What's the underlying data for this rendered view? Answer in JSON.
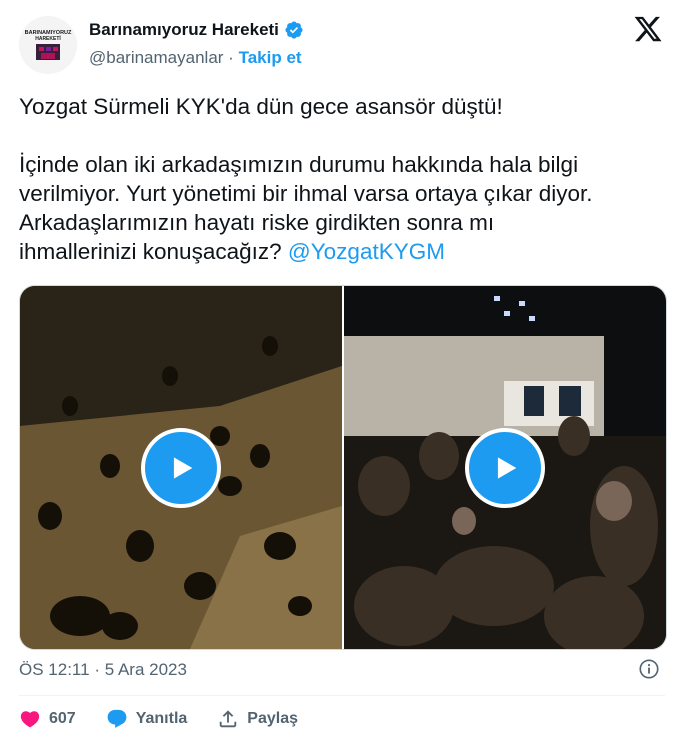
{
  "account": {
    "display_name": "Barınamıyoruz Hareketi",
    "handle": "@barinamayanlar",
    "separator": "·",
    "follow_label": "Takip et",
    "avatar_text_line1": "BARINAMIYORUZ",
    "avatar_text_line2": "HAREKETİ",
    "avatar_icon": "avatar-logo",
    "verified_icon": "verified-badge-icon"
  },
  "tweet": {
    "paragraph1": "Yozgat Sürmeli KYK'da dün gece asansör düştü!",
    "paragraph2_line1": "İçinde olan iki arkadaşımızın durumu hakkında hala bilgi",
    "paragraph2_line2": "verilmiyor. Yurt yönetimi bir ihmal varsa ortaya çıkar diyor.",
    "paragraph2_line3": "Arkadaşlarımızın hayatı riske girdikten sonra mı",
    "paragraph2_line4": "ihmallerinizi konuşacağız? ",
    "mention": "@YozgatKYGM"
  },
  "media": {
    "videos": [
      {
        "icon": "play-icon"
      },
      {
        "icon": "play-icon"
      }
    ]
  },
  "meta": {
    "time": "ÖS 12:11",
    "separator": "·",
    "date": "5 Ara 2023"
  },
  "actions": {
    "likes": "607",
    "reply_label": "Yanıtla",
    "share_label": "Paylaş"
  },
  "colors": {
    "accent": "#1d9bf0",
    "like": "#f91880",
    "text": "#0f1419",
    "muted": "#536471"
  }
}
